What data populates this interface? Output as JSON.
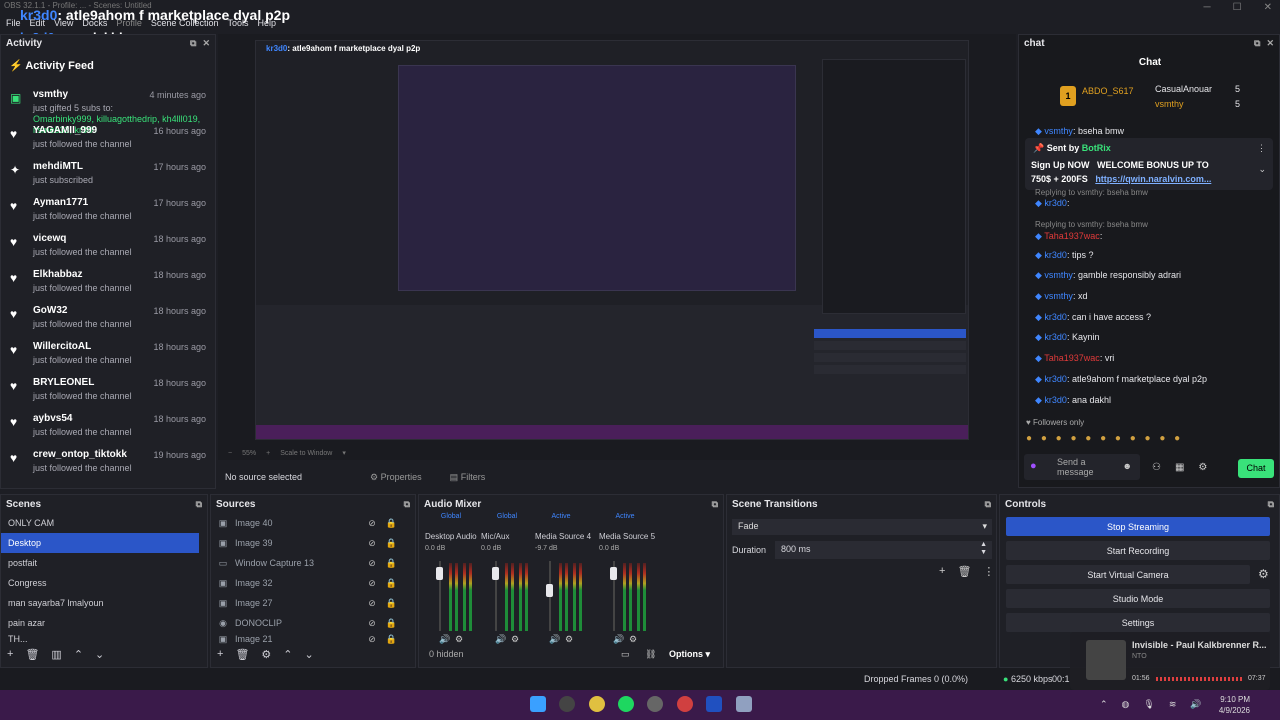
{
  "window": {
    "title_user": "kr3d0",
    "title_text": ": atle9ahom f marketplace dyal p2p",
    "subtitle_text": ": ana dakhl",
    "faded_title": "OBS 32.1.1 - Profile: ... - Scenes: Untitled"
  },
  "menu": [
    "File",
    "Edit",
    "View",
    "Docks",
    "Profile",
    "Scene Collection",
    "Tools",
    "Help"
  ],
  "activity": {
    "dock_title": "Activity",
    "feed_title": "Activity Feed",
    "items": [
      {
        "name": "vsmthy",
        "time": "4 minutes ago",
        "line1": "just gifted 5 subs to:",
        "line2": "Omarbinky999, killuagotthedrip, kh4lll019, itsme533, kr3d0",
        "icon": "gift-icon"
      },
      {
        "name": "YAGAMII_999",
        "time": "16 hours ago",
        "line1": "just followed the channel",
        "icon": "heart-icon"
      },
      {
        "name": "mehdiMTL",
        "time": "17 hours ago",
        "line1": "just subscribed",
        "icon": "star-icon"
      },
      {
        "name": "Ayman1771",
        "time": "17 hours ago",
        "line1": "just followed the channel",
        "icon": "heart-icon"
      },
      {
        "name": "vicewq",
        "time": "18 hours ago",
        "line1": "just followed the channel",
        "icon": "heart-icon"
      },
      {
        "name": "Elkhabbaz",
        "time": "18 hours ago",
        "line1": "just followed the channel",
        "icon": "heart-icon"
      },
      {
        "name": "GoW32",
        "time": "18 hours ago",
        "line1": "just followed the channel",
        "icon": "heart-icon"
      },
      {
        "name": "WillercitoAL",
        "time": "18 hours ago",
        "line1": "just followed the channel",
        "icon": "heart-icon"
      },
      {
        "name": "BRYLEONEL",
        "time": "18 hours ago",
        "line1": "just followed the channel",
        "icon": "heart-icon"
      },
      {
        "name": "aybvs54",
        "time": "18 hours ago",
        "line1": "just followed the channel",
        "icon": "heart-icon"
      },
      {
        "name": "crew_ontop_tiktokk",
        "time": "19 hours ago",
        "line1": "just followed the channel",
        "icon": "heart-icon"
      }
    ]
  },
  "preview": {
    "zoom": "55%",
    "scale_mode": "Scale to Window",
    "no_source": "No source selected",
    "properties": "Properties",
    "filters": "Filters"
  },
  "chat": {
    "dock_title": "chat",
    "header": "Chat",
    "leaders": [
      {
        "rank": "1",
        "name": "ABDO_S617",
        "count": ""
      },
      {
        "rank": "",
        "name": "CasualAnouar",
        "count": "5"
      },
      {
        "rank": "",
        "name": "vsmthy",
        "count": "5"
      }
    ],
    "pinned_sender": "Sent by",
    "pinned_bot": "BotRix",
    "pinned_line1": "Sign Up NOW",
    "pinned_bonus": "WELCOME BONUS UP TO",
    "pinned_line2": "750$ + 200FS",
    "pinned_link": "https://qwin.naralvin.com...",
    "messages": [
      {
        "user": "vsmthy",
        "text": ": bseha bmw",
        "cls": "chat-user"
      },
      {
        "user": "",
        "text": "Replying to vsmthy: bseha bmw",
        "cls": "reply"
      },
      {
        "user": "kr3d0",
        "text": ":",
        "cls": "chat-user"
      },
      {
        "user": "",
        "text": "Replying to vsmthy: bseha bmw",
        "cls": "reply"
      },
      {
        "user": "Taha1937wac",
        "text": ":",
        "cls": "chat-red"
      },
      {
        "user": "kr3d0",
        "text": ": tips ?",
        "cls": "chat-user"
      },
      {
        "user": "vsmthy",
        "text": ": gamble responsibly adrari",
        "cls": "chat-user"
      },
      {
        "user": "vsmthy",
        "text": ": xd",
        "cls": "chat-user"
      },
      {
        "user": "kr3d0",
        "text": ": can i have access ?",
        "cls": "chat-user"
      },
      {
        "user": "kr3d0",
        "text": ": Kaynin",
        "cls": "chat-user"
      },
      {
        "user": "Taha1937wac",
        "text": ": vri",
        "cls": "chat-red"
      },
      {
        "user": "kr3d0",
        "text": ": atle9ahom f marketplace dyal p2p",
        "cls": "chat-user"
      },
      {
        "user": "kr3d0",
        "text": ": ana dakhl",
        "cls": "chat-user"
      }
    ],
    "followers_only": "Followers only",
    "send_placeholder": "Send a message",
    "chat_button": "Chat"
  },
  "scenes": {
    "title": "Scenes",
    "items": [
      "ONLY CAM",
      "Desktop",
      "postfait",
      "Congress",
      "man sayarba7 lmalyoun",
      "pain azar",
      "TH..."
    ],
    "selected": 1
  },
  "sources": {
    "title": "Sources",
    "items": [
      "Image 40",
      "Image 39",
      "Window Capture 13",
      "Image 32",
      "Image 27",
      "DONOCLIP",
      "Image 21"
    ]
  },
  "mixer": {
    "title": "Audio Mixer",
    "channels": [
      {
        "tag": "Global",
        "name": "Desktop Audio",
        "db": "0.0 dB",
        "fader": 0.9
      },
      {
        "tag": "Global",
        "name": "Mic/Aux",
        "db": "0.0 dB",
        "fader": 0.9
      },
      {
        "tag": "Active",
        "name": "Media Source 4",
        "db": "-9.7 dB",
        "fader": 0.62
      },
      {
        "tag": "Active",
        "name": "Media Source 5",
        "db": "0.0 dB",
        "fader": 0.9
      }
    ],
    "hidden": "0 hidden",
    "options": "Options"
  },
  "transitions": {
    "title": "Scene Transitions",
    "type": "Fade",
    "duration_label": "Duration",
    "duration_value": "800 ms"
  },
  "controls": {
    "title": "Controls",
    "buttons": [
      "Stop Streaming",
      "Start Recording",
      "Start Virtual Camera",
      "Studio Mode",
      "Settings"
    ]
  },
  "status": {
    "dropped": "Dropped Frames 0 (0.0%)",
    "bitrate": "6250 kbps",
    "live_time": "00:1"
  },
  "media": {
    "title": "Invisible - Paul Kalkbrenner R...",
    "artist": "NTO",
    "elapsed": "01:56",
    "total": "07:37"
  },
  "clock": {
    "time": "9:10 PM",
    "date": "4/9/2026"
  },
  "colors": {
    "accent": "#2b56c8",
    "bg": "#1f2026",
    "green": "#39e27a",
    "taskbar": "#3a1a4a"
  }
}
